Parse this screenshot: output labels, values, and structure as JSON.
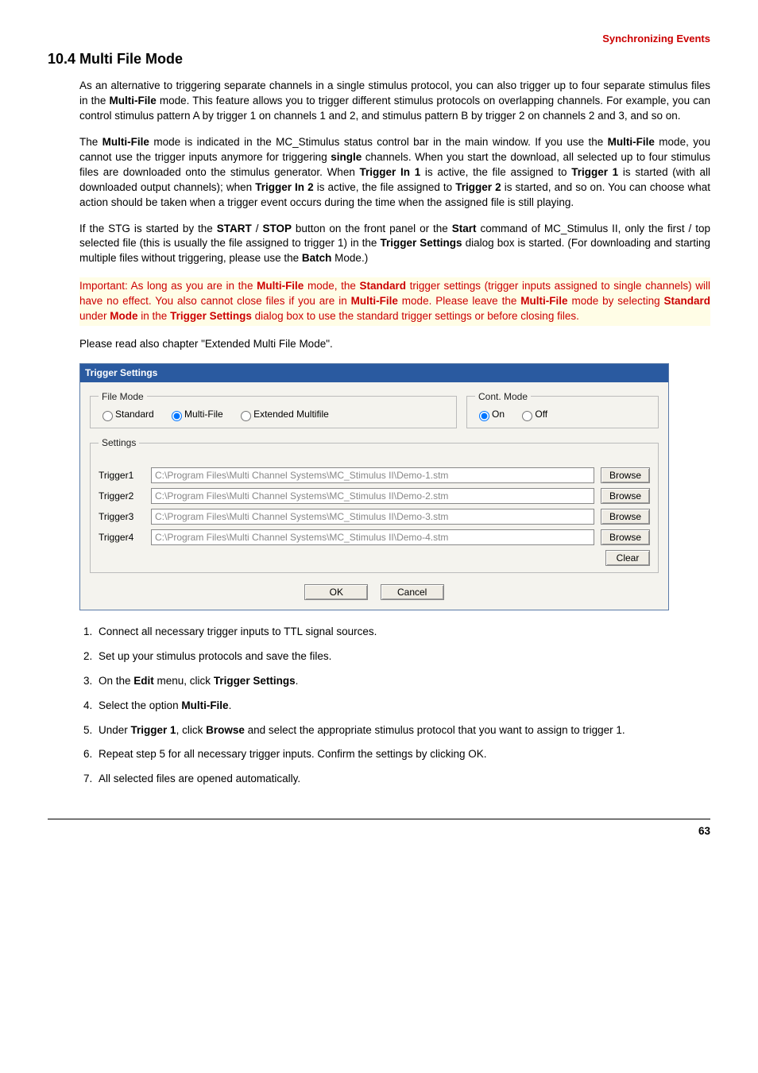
{
  "header": {
    "right": "Synchronizing Events"
  },
  "title": "10.4 Multi File Mode",
  "paragraphs": {
    "p1_a": "As an alternative to triggering separate channels in a single stimulus protocol, you can also trigger up to four separate stimulus files in the ",
    "p1_b_bold": "Multi-File",
    "p1_c": " mode. This feature allows you to trigger different stimulus protocols on overlapping channels. For example, you can control stimulus pattern A by trigger 1 on channels 1 and 2, and stimulus pattern B by trigger 2 on channels 2 and 3, and so on.",
    "p2_a": "The ",
    "p2_b_bold": "Multi-File",
    "p2_c": " mode is indicated in the MC_Stimulus status control bar in the main window. If you use the ",
    "p2_d_bold": "Multi-File",
    "p2_e": " mode, you cannot use the trigger inputs anymore for triggering ",
    "p2_f_bold": "single",
    "p2_g": " channels. When you start the download, all selected up to four stimulus files are downloaded onto the stimulus generator. When ",
    "p2_h_bold": "Trigger In 1",
    "p2_i": " is active, the file assigned to ",
    "p2_j_bold": "Trigger 1",
    "p2_k": " is started (with all downloaded output channels); when ",
    "p2_l_bold": "Trigger In 2",
    "p2_m": " is active, the file assigned to ",
    "p2_n_bold": "Trigger 2",
    "p2_o": " is started, and so on. You can choose what action should be taken when a trigger event occurs during the time when the assigned file is still playing.",
    "p3_a": "If the STG is started by the ",
    "p3_b_bold": "START",
    "p3_c": " / ",
    "p3_d_bold": "STOP",
    "p3_e": " button on the front panel or the ",
    "p3_f_bold": "Start",
    "p3_g": " command of MC_Stimulus II, only the first / top selected file (this is usually the file assigned to trigger 1) in the ",
    "p3_h_bold": "Trigger Settings",
    "p3_i": " dialog box is started. (For downloading and starting multiple files without triggering, please use the ",
    "p3_j_bold": "Batch",
    "p3_k": " Mode.)",
    "imp_a": "Important: As long as you are in the ",
    "imp_b_bold": "Multi-File",
    "imp_c": " mode, the ",
    "imp_d_bold": "Standard",
    "imp_e": " trigger settings (trigger inputs assigned to single channels) will have no effect. You also cannot close files if you are in ",
    "imp_f_bold": "Multi-File",
    "imp_g": " mode. Please leave the ",
    "imp_h_bold": "Multi-File",
    "imp_i": " mode by selecting ",
    "imp_j_bold": "Standard",
    "imp_k": " under ",
    "imp_l_bold": "Mode",
    "imp_m": " in the ",
    "imp_n_bold": "Trigger Settings",
    "imp_o": " dialog box to use the standard trigger settings or before closing files.",
    "p5": "Please read also chapter \"Extended Multi File Mode\"."
  },
  "dialog": {
    "title": "Trigger Settings",
    "file_mode_legend": "File Mode",
    "cont_mode_legend": "Cont. Mode",
    "settings_legend": "Settings",
    "radios": {
      "standard": "Standard",
      "multifile": "Multi-File",
      "extended": "Extended Multifile",
      "on": "On",
      "off": "Off"
    },
    "triggers": [
      {
        "label": "Trigger1",
        "path": "C:\\Program Files\\Multi Channel Systems\\MC_Stimulus II\\Demo-1.stm"
      },
      {
        "label": "Trigger2",
        "path": "C:\\Program Files\\Multi Channel Systems\\MC_Stimulus II\\Demo-2.stm"
      },
      {
        "label": "Trigger3",
        "path": "C:\\Program Files\\Multi Channel Systems\\MC_Stimulus II\\Demo-3.stm"
      },
      {
        "label": "Trigger4",
        "path": "C:\\Program Files\\Multi Channel Systems\\MC_Stimulus II\\Demo-4.stm"
      }
    ],
    "buttons": {
      "browse": "Browse",
      "clear": "Clear",
      "ok": "OK",
      "cancel": "Cancel"
    }
  },
  "steps": {
    "s1": "Connect all necessary trigger inputs to TTL signal sources.",
    "s2": "Set up your stimulus protocols and save the files.",
    "s3_a": "On the ",
    "s3_b_bold": "Edit",
    "s3_c": " menu, click ",
    "s3_d_bold": "Trigger Settings",
    "s3_e": ".",
    "s4_a": "Select the option ",
    "s4_b_bold": "Multi-File",
    "s4_c": ".",
    "s5_a": "Under ",
    "s5_b_bold": "Trigger 1",
    "s5_c": ", click ",
    "s5_d_bold": "Browse",
    "s5_e": " and select the appropriate stimulus protocol that you want to assign to trigger 1.",
    "s6": "Repeat step 5 for all necessary trigger inputs. Confirm the settings by clicking OK.",
    "s7": "All selected files are opened automatically."
  },
  "page_number": "63"
}
